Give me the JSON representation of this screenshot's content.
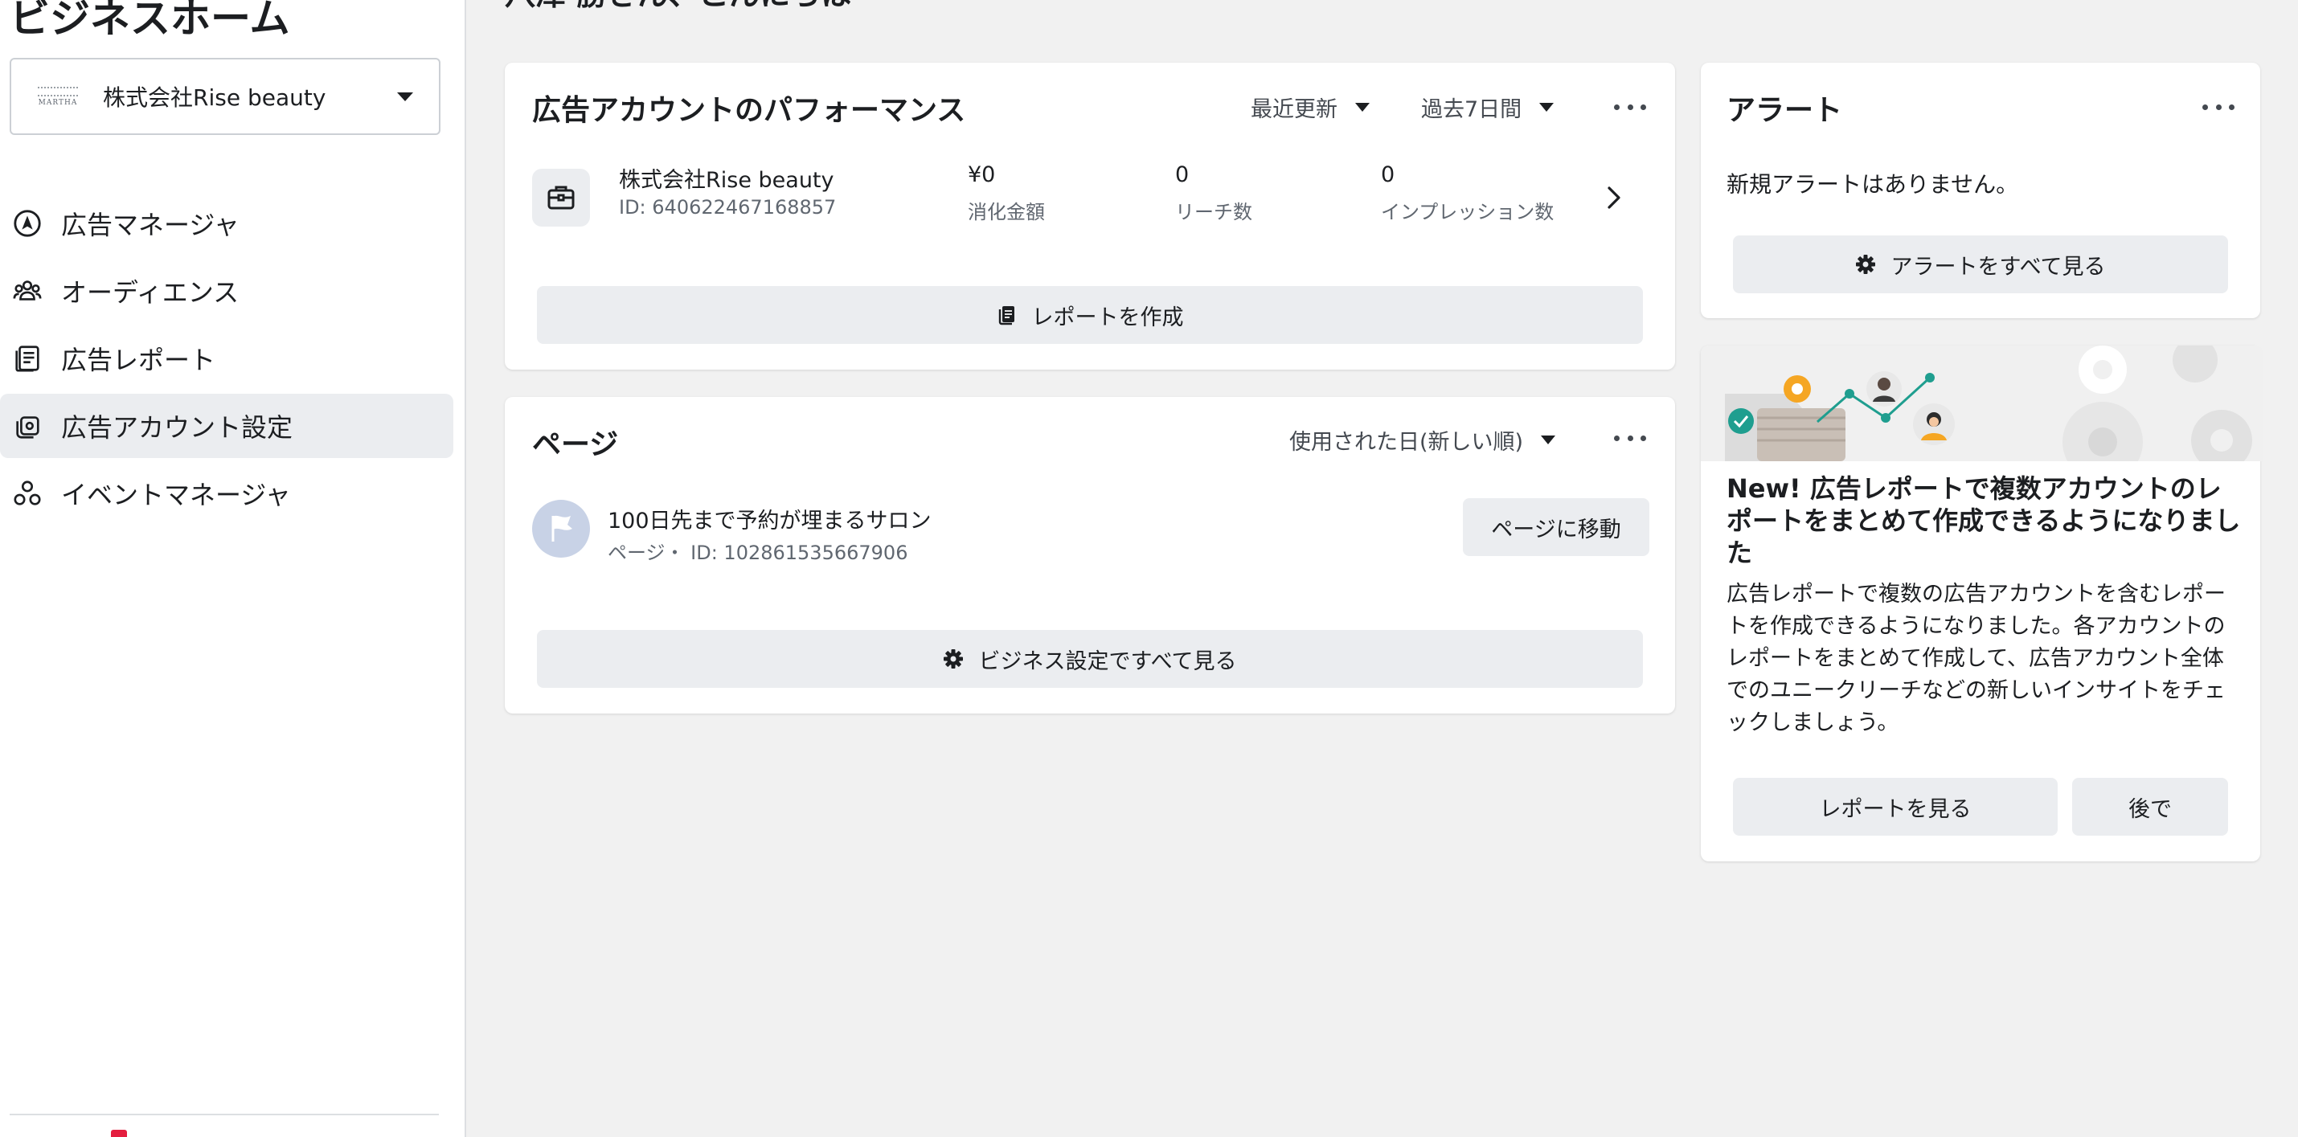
{
  "sidebar": {
    "title": "ビジネスホーム",
    "account_selector": {
      "logo_text": "MARTHA",
      "name": "株式会社Rise beauty"
    },
    "nav_items": [
      {
        "label": "広告マネージャ",
        "icon": "compass-icon"
      },
      {
        "label": "オーディエンス",
        "icon": "people-icon"
      },
      {
        "label": "広告レポート",
        "icon": "report-icon"
      },
      {
        "label": "広告アカウント設定",
        "icon": "account-settings-icon",
        "active": true
      },
      {
        "label": "イベントマネージャ",
        "icon": "event-manager-icon"
      }
    ]
  },
  "main": {
    "greeting": "八澤 勝さん、こんにちは",
    "performance": {
      "title": "広告アカウントのパフォーマンス",
      "sort_dropdown": "最近更新",
      "range_dropdown": "過去7日間",
      "account_name": "株式会社Rise beauty",
      "account_id": "ID: 640622467168857",
      "stats": [
        {
          "value": "¥0",
          "label": "消化金額"
        },
        {
          "value": "0",
          "label": "リーチ数"
        },
        {
          "value": "0",
          "label": "インプレッション数"
        }
      ],
      "create_report_button": "レポートを作成"
    },
    "pages": {
      "title": "ページ",
      "sort_dropdown": "使用された日(新しい順)",
      "page_name": "100日先まで予約が埋まるサロン",
      "page_meta": "ページ・ ID: 102861535667906",
      "go_to_page_button": "ページに移動",
      "see_all_button": "ビジネス設定ですべて見る"
    }
  },
  "alerts": {
    "title": "アラート",
    "empty_text": "新規アラートはありません。",
    "see_all_button": "アラートをすべて見る"
  },
  "promo": {
    "title": "New! 広告レポートで複数アカウントのレポートをまとめて作成できるようになりました",
    "body": "広告レポートで複数の広告アカウントを含むレポートを作成できるようになりました。各アカウントのレポートをまとめて作成して、広告アカウント全体でのユニークリーチなどの新しいインサイトをチェックしましょう。",
    "view_button": "レポートを見る",
    "later_button": "後で"
  },
  "colors": {
    "background": "#f1f1f1",
    "card": "#ffffff",
    "button_gray": "#ebedf0",
    "text": "#1c1e21",
    "muted": "#606770",
    "accent_teal": "#1f9e8f",
    "accent_orange": "#f5a623"
  }
}
